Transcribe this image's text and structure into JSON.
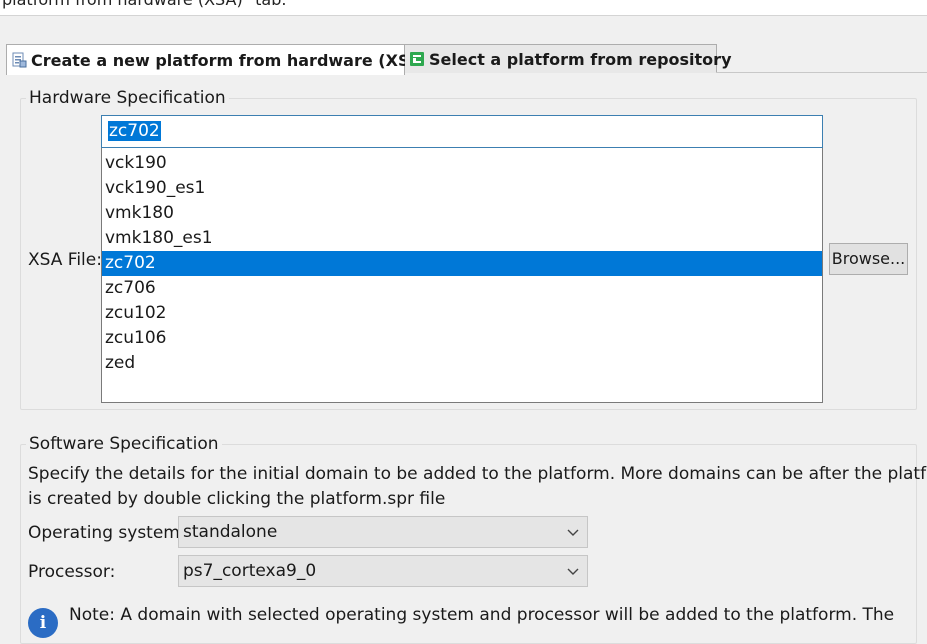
{
  "top_strip_text": "platform from hardware (XSA)\" tab.",
  "tabs": [
    {
      "label": "Create a new platform from hardware (XSA)",
      "icon": "hardware-platform-icon"
    },
    {
      "label": "Select a platform from repository",
      "icon": "repository-platform-icon"
    }
  ],
  "hardware": {
    "group_label": "Hardware Specification",
    "xsa_label": "XSA File:",
    "xsa_value": "zc702",
    "options": [
      "vck190",
      "vck190_es1",
      "vmk180",
      "vmk180_es1",
      "zc702",
      "zc706",
      "zcu102",
      "zcu106",
      "zed"
    ],
    "selected_option": "zc702",
    "browse_label": "Browse..."
  },
  "software": {
    "group_label": "Software Specification",
    "description_line1": "Specify the details for the initial domain to be added to the platform. More domains can be after the platform",
    "description_line2": "is created by double clicking the platform.spr file",
    "os_label": "Operating system:",
    "os_value": "standalone",
    "processor_label": "Processor:",
    "processor_value": "ps7_cortexa9_0",
    "note": "Note: A domain with selected operating system and processor will be added to the platform. The"
  },
  "colors": {
    "selection": "#0078d7",
    "focus_border": "#3c7fb1",
    "info": "#2b6cc4"
  }
}
